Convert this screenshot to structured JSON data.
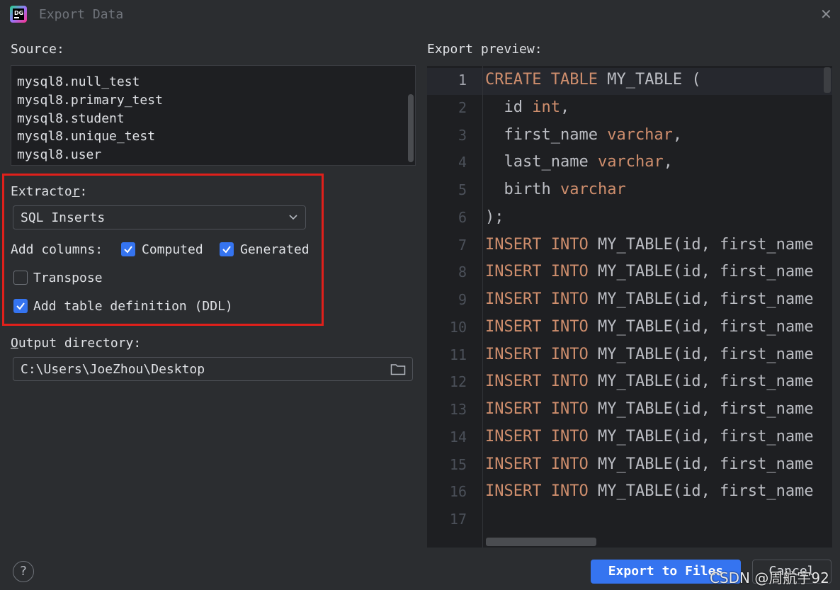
{
  "window": {
    "title": "Export Data",
    "close_icon": "close-icon"
  },
  "source": {
    "label": "Source:",
    "items": [
      "mysql8.null_test",
      "mysql8.primary_test",
      "mysql8.student",
      "mysql8.unique_test",
      "mysql8.user"
    ]
  },
  "extractor": {
    "label_pre": "Extract",
    "label_o": "o",
    "label_u": "r",
    "label_post": ":",
    "selected": "SQL Inserts"
  },
  "add_columns": {
    "label": "Add columns:",
    "computed": {
      "label": "Computed",
      "checked": true
    },
    "generated": {
      "label": "Generated",
      "checked": true
    }
  },
  "transpose": {
    "label": "Transpose",
    "checked": false
  },
  "ddl": {
    "label": "Add table definition (DDL)",
    "checked": true
  },
  "output": {
    "label_u": "O",
    "label_rest": "utput directory:",
    "path": "C:\\Users\\JoeZhou\\Desktop"
  },
  "preview": {
    "label": "Export preview:",
    "line_numbers": [
      "1",
      "2",
      "3",
      "4",
      "5",
      "6",
      "7",
      "8",
      "9",
      "10",
      "11",
      "12",
      "13",
      "14",
      "15",
      "16",
      "17"
    ],
    "create": {
      "kw1": "CREATE",
      "kw2": "TABLE",
      "name": " MY_TABLE (",
      "indent": "  "
    },
    "columns": [
      {
        "name": "id",
        "type": "int",
        "sep": ","
      },
      {
        "name": "first_name",
        "type": "varchar",
        "sep": ","
      },
      {
        "name": "last_name",
        "type": "varchar",
        "sep": ","
      },
      {
        "name": "birth",
        "type": "varchar",
        "sep": ""
      }
    ],
    "close": ");",
    "insert": {
      "kw1": "INSERT",
      "kw2": "INTO",
      "rest": " MY_TABLE(id, first_name"
    }
  },
  "footer": {
    "help": "?",
    "export_label": "Export to Files",
    "cancel_label": "Cancel"
  },
  "watermark": "CSDN @周航宇92",
  "colors": {
    "accent": "#3574f0",
    "highlight": "#e0201b",
    "keyword": "#cf8e6d"
  }
}
